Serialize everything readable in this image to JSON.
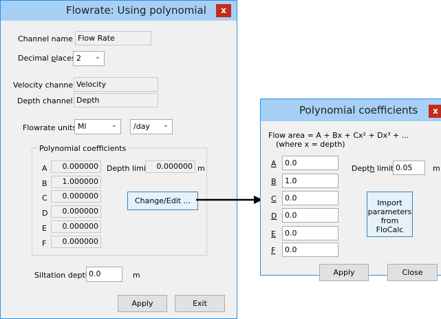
{
  "main": {
    "title": "Flowrate: Using polynomial",
    "close_glyph": "x",
    "channel_name_label": "Channel name",
    "channel_name_value": "Flow Rate",
    "decimal_label_pre": "Decimal ",
    "decimal_label_key": "p",
    "decimal_label_post": "laces",
    "decimal_value": "2",
    "velocity_label": "Velocity channel",
    "velocity_value": "Velocity",
    "depth_label": "Depth channel",
    "depth_value": "Depth",
    "flowrate_units_label": "Flowrate units",
    "units_volume": "Ml",
    "units_time": "/day",
    "group_title": "Polynomial coefficients",
    "coefficients": [
      {
        "label": "A",
        "value": "0.000000"
      },
      {
        "label": "B",
        "value": "1.000000"
      },
      {
        "label": "C",
        "value": "0.000000"
      },
      {
        "label": "D",
        "value": "0.000000"
      },
      {
        "label": "E",
        "value": "0.000000"
      },
      {
        "label": "F",
        "value": "0.000000"
      }
    ],
    "depth_limit_label": "Depth limit",
    "depth_limit_value": "0.000000",
    "depth_limit_unit": "m",
    "change_edit_label": "Change/Edit ...",
    "siltation_label": "Siltation depth",
    "siltation_value": "0.0",
    "siltation_unit": "m",
    "apply_label": "Apply",
    "exit_label": "Exit"
  },
  "poly": {
    "title": "Polynomial coefficients",
    "close_glyph": "x",
    "formula_line1": "Flow area = A + Bx + Cx² + Dx³ + ...",
    "formula_line2": "(where x = depth)",
    "coefficients": [
      {
        "label": "A",
        "value": "0.0"
      },
      {
        "label": "B",
        "value": "1.0"
      },
      {
        "label": "C",
        "value": "0.0"
      },
      {
        "label": "D",
        "value": "0.0"
      },
      {
        "label": "E",
        "value": "0.0"
      },
      {
        "label": "F",
        "value": "0.0"
      }
    ],
    "depth_limit_pre": "Dept",
    "depth_limit_key": "h",
    "depth_limit_post": " limit",
    "depth_limit_value": "0.05",
    "depth_limit_unit": "m",
    "import_line1": "Import",
    "import_line2": "parameters",
    "import_line3": "from FloCalc",
    "apply_label": "Apply",
    "close_label": "Close"
  },
  "colors": {
    "title_bar": "#a6d0f5",
    "close_button": "#c42b1c",
    "window_border": "#2d8ee0",
    "arrow": "#000000"
  }
}
